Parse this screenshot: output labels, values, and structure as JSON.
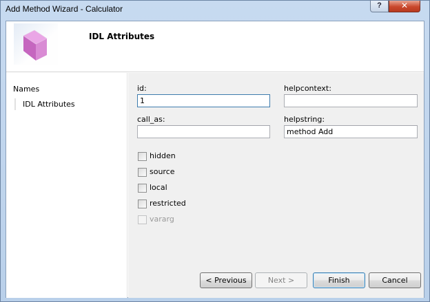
{
  "window": {
    "title": "Add Method Wizard - Calculator",
    "help_button": "?",
    "close_button": "✕"
  },
  "header": {
    "title": "IDL Attributes",
    "icon": "pink-cube-icon"
  },
  "nav": {
    "items": [
      {
        "label": "Names",
        "selected": false
      },
      {
        "label": "IDL Attributes",
        "selected": true
      }
    ]
  },
  "fields": {
    "id": {
      "label": "id:",
      "value": "1"
    },
    "helpcontext": {
      "label": "helpcontext:",
      "value": ""
    },
    "call_as": {
      "label": "call_as:",
      "value": ""
    },
    "helpstring": {
      "label": "helpstring:",
      "value": "method Add"
    }
  },
  "checkboxes": [
    {
      "label": "hidden",
      "checked": false,
      "enabled": true
    },
    {
      "label": "source",
      "checked": false,
      "enabled": true
    },
    {
      "label": "local",
      "checked": false,
      "enabled": true
    },
    {
      "label": "restricted",
      "checked": false,
      "enabled": true
    },
    {
      "label": "vararg",
      "checked": false,
      "enabled": false
    }
  ],
  "buttons": {
    "previous": "< Previous",
    "next": "Next >",
    "finish": "Finish",
    "cancel": "Cancel"
  }
}
